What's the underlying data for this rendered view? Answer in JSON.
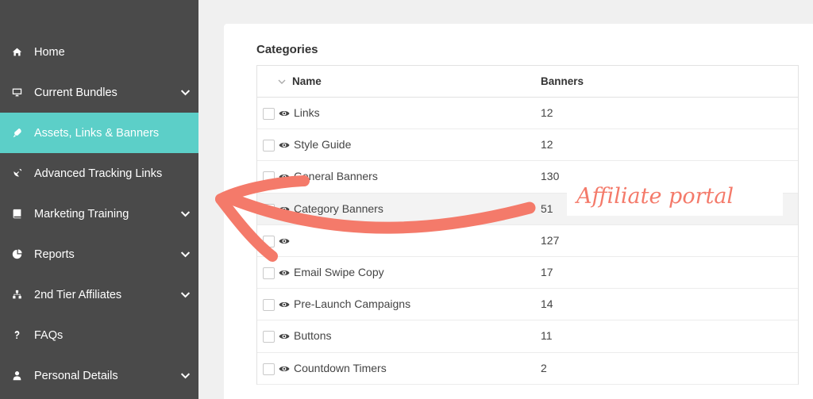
{
  "sidebar": {
    "items": [
      {
        "label": "Home",
        "icon": "home-icon",
        "has_chevron": false,
        "active": false
      },
      {
        "label": "Current Bundles",
        "icon": "monitor-icon",
        "has_chevron": true,
        "active": false
      },
      {
        "label": "Assets, Links & Banners",
        "icon": "rocket-icon",
        "has_chevron": false,
        "active": true
      },
      {
        "label": "Advanced Tracking Links",
        "icon": "satellite-icon",
        "has_chevron": false,
        "active": false
      },
      {
        "label": "Marketing Training",
        "icon": "book-icon",
        "has_chevron": true,
        "active": false
      },
      {
        "label": "Reports",
        "icon": "pie-chart-icon",
        "has_chevron": true,
        "active": false
      },
      {
        "label": "2nd Tier Affiliates",
        "icon": "sitemap-icon",
        "has_chevron": true,
        "active": false
      },
      {
        "label": "FAQs",
        "icon": "question-icon",
        "has_chevron": false,
        "active": false
      },
      {
        "label": "Personal Details",
        "icon": "user-icon",
        "has_chevron": true,
        "active": false
      }
    ]
  },
  "categories": {
    "title": "Categories",
    "columns": {
      "name": "Name",
      "banners": "Banners"
    },
    "rows": [
      {
        "name": "Links",
        "banners": "12"
      },
      {
        "name": "Style Guide",
        "banners": "12"
      },
      {
        "name": "General Banners",
        "banners": "130"
      },
      {
        "name": "Category Banners",
        "banners": "51"
      },
      {
        "name": "",
        "banners": "127"
      },
      {
        "name": "Email Swipe Copy",
        "banners": "17"
      },
      {
        "name": "Pre-Launch Campaigns",
        "banners": "14"
      },
      {
        "name": "Buttons",
        "banners": "11"
      },
      {
        "name": "Countdown Timers",
        "banners": "2"
      }
    ]
  },
  "annotation": {
    "text": "Affiliate portal"
  },
  "colors": {
    "sidebar": "#4a4a4a",
    "active": "#5ccfc8",
    "annotation": "#f47a6a"
  }
}
